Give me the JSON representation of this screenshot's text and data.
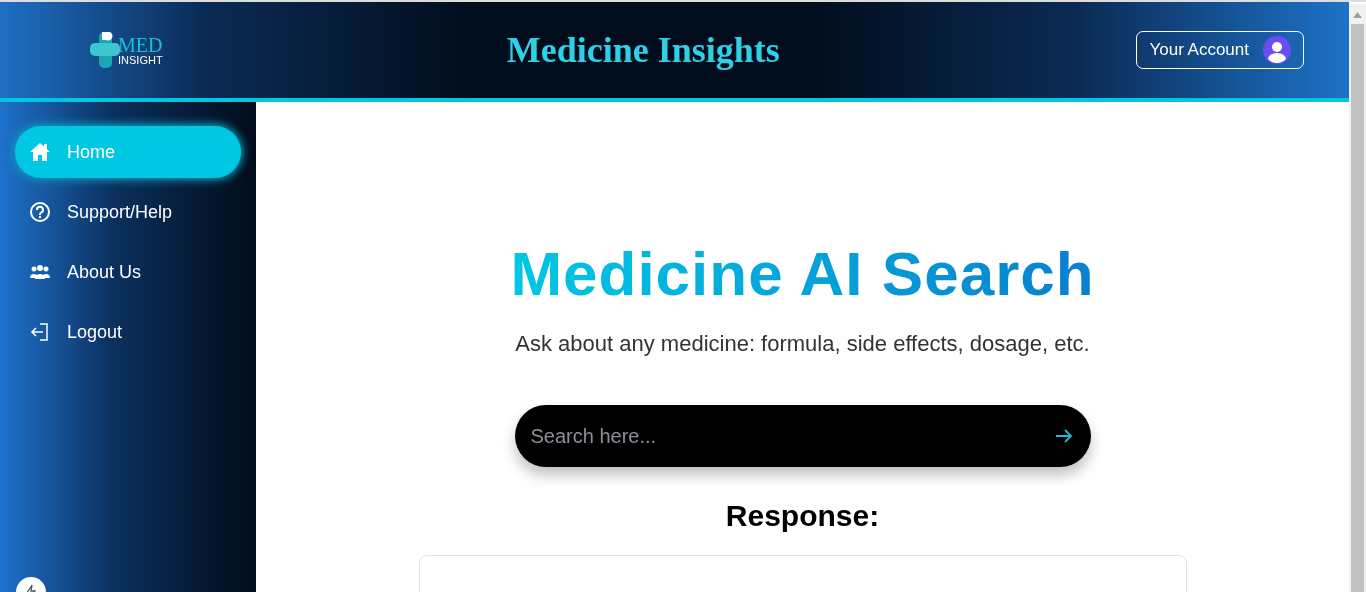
{
  "header": {
    "logo": {
      "line1": "MED",
      "line2": "INSIGHT"
    },
    "title": "Medicine Insights",
    "account_button": "Your Account"
  },
  "sidebar": {
    "items": [
      {
        "label": "Home",
        "selected": true
      },
      {
        "label": "Support/Help",
        "selected": false
      },
      {
        "label": "About Us",
        "selected": false
      },
      {
        "label": "Logout",
        "selected": false
      }
    ]
  },
  "main": {
    "title": "Medicine AI Search",
    "subtitle": "Ask about any medicine: formula, side effects, dosage, etc.",
    "search": {
      "placeholder": "Search here..."
    },
    "response_heading": "Response:"
  }
}
